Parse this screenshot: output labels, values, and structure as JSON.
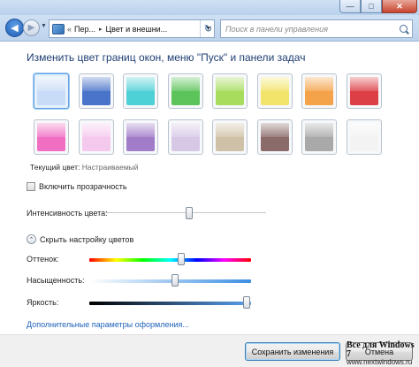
{
  "window": {
    "minimize_icon": "minimize-icon",
    "maximize_icon": "maximize-icon",
    "close_icon": "close-icon",
    "minimize_glyph": "—",
    "maximize_glyph": "□",
    "close_glyph": "✕"
  },
  "addressbar": {
    "back_glyph": "◀",
    "forward_glyph": "▶",
    "recent_glyph": "▼",
    "sep_glyph": "«",
    "crumbs": [
      "Пер...",
      "Цвет и внешни..."
    ],
    "crumb_arrow": "▸",
    "crumb_drop": "▼",
    "refresh_glyph": "↻"
  },
  "search": {
    "placeholder": "Поиск в панели управления"
  },
  "main": {
    "title": "Изменить цвет границ окон, меню \"Пуск\" и панели задач",
    "swatches": [
      {
        "name": "sky",
        "color": "#c9dcf7",
        "selected": true
      },
      {
        "name": "twilight",
        "color": "#4a74c9"
      },
      {
        "name": "sea",
        "color": "#4dd0d6"
      },
      {
        "name": "leaf",
        "color": "#5cc45a"
      },
      {
        "name": "lime",
        "color": "#a7dc5c"
      },
      {
        "name": "lemon",
        "color": "#f2e46a"
      },
      {
        "name": "orange",
        "color": "#f4a34a"
      },
      {
        "name": "red",
        "color": "#dc4046"
      },
      {
        "name": "pink",
        "color": "#f06fc3"
      },
      {
        "name": "blush",
        "color": "#f5c8ee"
      },
      {
        "name": "violet",
        "color": "#a07cc9"
      },
      {
        "name": "lavender",
        "color": "#d7c9e6"
      },
      {
        "name": "taupe",
        "color": "#cfc1a8"
      },
      {
        "name": "chocolate",
        "color": "#8b6a6a"
      },
      {
        "name": "slate",
        "color": "#a9a9a9"
      },
      {
        "name": "frost",
        "color": "#f3f3f3"
      }
    ],
    "current_color_label": "Текущий цвет:",
    "current_color_value": "Настраиваемый",
    "transparency_label": "Включить прозрачность",
    "transparency_checked": false,
    "intensity_label": "Интенсивность цвета:",
    "intensity_value": 0.52,
    "collapse_glyph": "⌃",
    "collapse_label": "Скрыть настройку цветов",
    "hue_label": "Оттенок:",
    "hue_value": 0.57,
    "saturation_label": "Насыщенность:",
    "saturation_value": 0.53,
    "brightness_label": "Яркость:",
    "brightness_value": 0.97,
    "advanced_link": "Дополнительные параметры оформления..."
  },
  "footer": {
    "save_label": "Сохранить изменения",
    "cancel_label": "Отмена"
  },
  "watermark": {
    "title": "Все для Windows 7",
    "subtitle": "www.nextwindows.ru"
  }
}
